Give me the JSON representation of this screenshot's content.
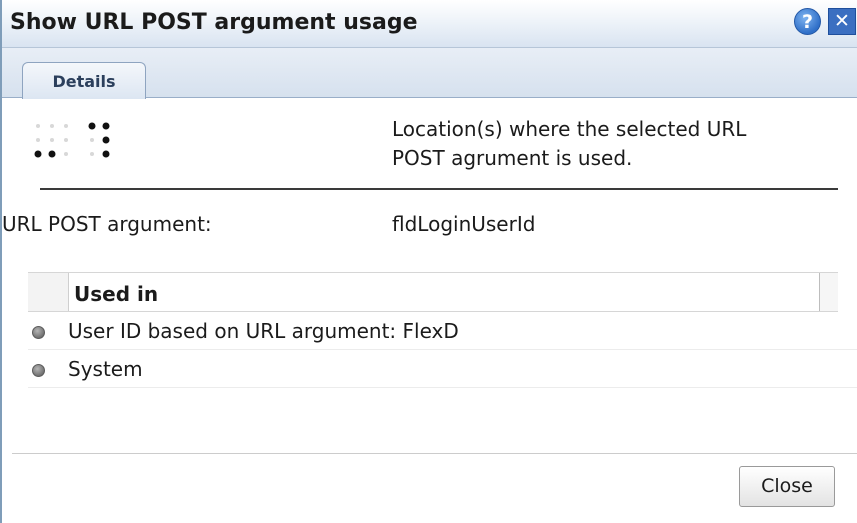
{
  "dialog": {
    "title": "Show URL POST argument usage",
    "help_symbol": "?",
    "close_symbol": "✕"
  },
  "tabs": [
    {
      "label": "Details"
    }
  ],
  "details": {
    "description_line1": "Location(s) where the selected URL",
    "description_line2": "POST agrument is used.",
    "field_label": "URL POST argument:",
    "field_value": "fldLoginUserId"
  },
  "used_in": {
    "header": "Used in",
    "rows": [
      {
        "label": "User ID based on URL argument: FlexD"
      },
      {
        "label": "System"
      }
    ]
  },
  "footer": {
    "close_label": "Close"
  },
  "colors": {
    "titlebar": "#d9e4f1",
    "help_button": "#2f6fc8",
    "close_button": "#3b6fc1"
  }
}
